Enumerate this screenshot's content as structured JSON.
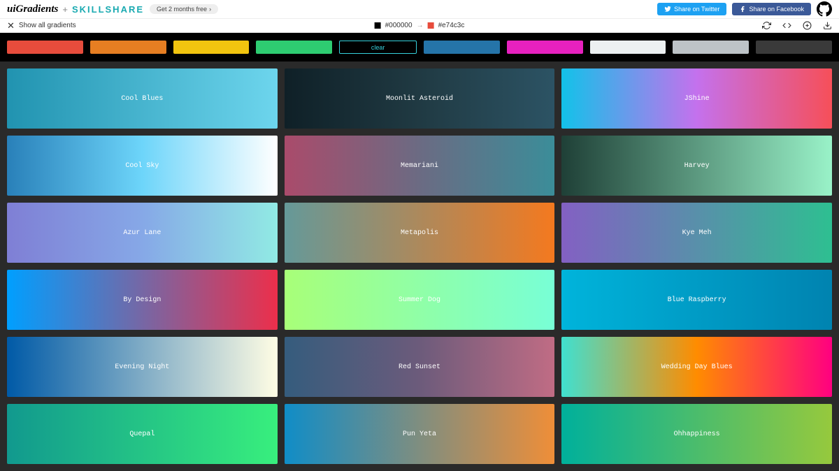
{
  "header": {
    "brand_ui": "uiGradients",
    "brand_plus": "+",
    "brand_ss": "SKILLSHARE",
    "promo": "Get 2 months free",
    "share_twitter": "Share on Twitter",
    "share_facebook": "Share on Facebook"
  },
  "subbar": {
    "show_all": "Show all gradients",
    "hex_from": "#000000",
    "hex_to": "#e74c3c",
    "swatch_from": "#000000",
    "swatch_to": "#e74c3c"
  },
  "filters": {
    "items": [
      {
        "bg": "#e74c3c",
        "label": ""
      },
      {
        "bg": "#e67e22",
        "label": ""
      },
      {
        "bg": "#f1c40f",
        "label": ""
      },
      {
        "bg": "#2ecc71",
        "label": ""
      },
      {
        "bg": "transparent",
        "label": "clear",
        "selected": true
      },
      {
        "bg": "#2574a9",
        "label": ""
      },
      {
        "bg": "#e721bf",
        "label": ""
      },
      {
        "bg": "#ecf0f1",
        "label": ""
      },
      {
        "bg": "#bdc3c7",
        "label": ""
      },
      {
        "bg": "#3a3a3a",
        "label": ""
      }
    ]
  },
  "gradients": [
    {
      "name": "Cool Blues",
      "css": "linear-gradient(90deg,#2193b0,#6dd5ed)"
    },
    {
      "name": "Moonlit Asteroid",
      "css": "linear-gradient(90deg,#0f2027,#203a43,#2c5364)"
    },
    {
      "name": "JShine",
      "css": "linear-gradient(90deg,#12c2e9,#c471ed,#f64f59)"
    },
    {
      "name": "Cool Sky",
      "css": "linear-gradient(90deg,#2980b9,#6dd5fa,#ffffff)"
    },
    {
      "name": "Memariani",
      "css": "linear-gradient(90deg,#aa4b6b,#6b6b83,#3b8d99)"
    },
    {
      "name": "Harvey",
      "css": "linear-gradient(90deg,#1f4037,#99f2c8)"
    },
    {
      "name": "Azur Lane",
      "css": "linear-gradient(90deg,#7f7fd5,#86a8e7,#91eae4)"
    },
    {
      "name": "Metapolis",
      "css": "linear-gradient(90deg,#659999,#f4791f)"
    },
    {
      "name": "Kye Meh",
      "css": "linear-gradient(90deg,#8360c3,#2ebf91)"
    },
    {
      "name": "By Design",
      "css": "linear-gradient(90deg,#009fff,#ec2f4b)"
    },
    {
      "name": "Summer Dog",
      "css": "linear-gradient(90deg,#a8ff78,#78ffd6)"
    },
    {
      "name": "Blue Raspberry",
      "css": "linear-gradient(90deg,#00b4db,#0083b0)"
    },
    {
      "name": "Evening Night",
      "css": "linear-gradient(90deg,#005aa7,#fffde4)"
    },
    {
      "name": "Red Sunset",
      "css": "linear-gradient(90deg,#355c7d,#6c5b7b,#c06c84)"
    },
    {
      "name": "Wedding Day Blues",
      "css": "linear-gradient(90deg,#40e0d0,#ff8c00,#ff0080)"
    },
    {
      "name": "Quepal",
      "css": "linear-gradient(90deg,#11998e,#38ef7d)"
    },
    {
      "name": "Pun Yeta",
      "css": "linear-gradient(90deg,#108dc7,#ef8e38)"
    },
    {
      "name": "Ohhappiness",
      "css": "linear-gradient(90deg,#00b09b,#96c93d)"
    }
  ]
}
